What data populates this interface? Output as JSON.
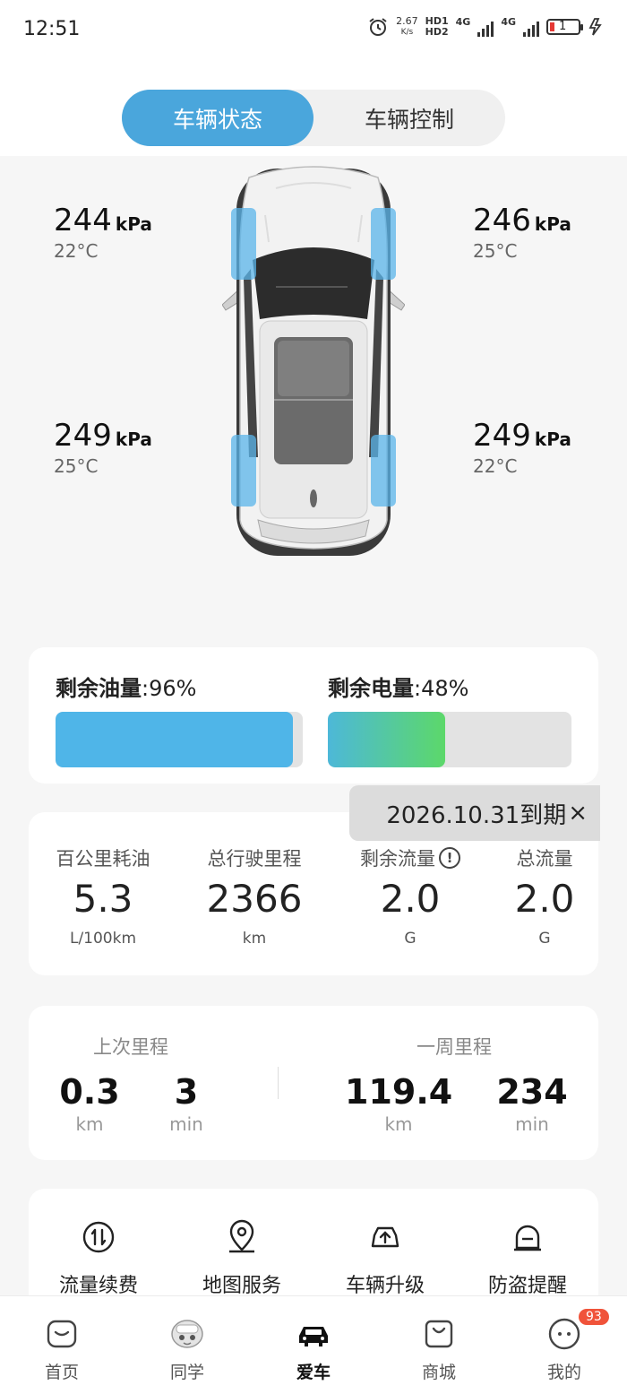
{
  "status_bar": {
    "time": "12:51",
    "net_speed_value": "2.67",
    "net_speed_unit": "K/s",
    "hd1": "HD1",
    "hd2": "HD2",
    "network1": "4G",
    "network2": "4G",
    "battery_level": "1"
  },
  "tabs": [
    {
      "label": "车辆状态",
      "active": true
    },
    {
      "label": "车辆控制",
      "active": false
    }
  ],
  "tires": {
    "front_left": {
      "pressure": "244",
      "unit": "kPa",
      "temp": "22°C"
    },
    "front_right": {
      "pressure": "246",
      "unit": "kPa",
      "temp": "25°C"
    },
    "rear_left": {
      "pressure": "249",
      "unit": "kPa",
      "temp": "25°C"
    },
    "rear_right": {
      "pressure": "249",
      "unit": "kPa",
      "temp": "22°C"
    }
  },
  "fuel": {
    "label": "剩余油量",
    "value": ":96%",
    "percent": 96
  },
  "battery": {
    "label": "剩余电量",
    "value": ":48%",
    "percent": 48
  },
  "expire_banner": {
    "text": "2026.10.31到期",
    "close": "×"
  },
  "stats": [
    {
      "label": "百公里耗油",
      "value": "5.3",
      "unit": "L/100km"
    },
    {
      "label": "总行驶里程",
      "value": "2366",
      "unit": "km"
    },
    {
      "label": "剩余流量",
      "value": "2.0",
      "unit": "G",
      "info": "!"
    },
    {
      "label": "总流量",
      "value": "2.0",
      "unit": "G"
    }
  ],
  "trips": {
    "last": {
      "label": "上次里程",
      "distance": "0.3",
      "distance_unit": "km",
      "duration": "3",
      "duration_unit": "min"
    },
    "week": {
      "label": "一周里程",
      "distance": "119.4",
      "distance_unit": "km",
      "duration": "234",
      "duration_unit": "min"
    }
  },
  "services": [
    {
      "label": "流量续费",
      "icon": "data-transfer-icon"
    },
    {
      "label": "地图服务",
      "icon": "map-pin-icon"
    },
    {
      "label": "车辆升级",
      "icon": "car-upgrade-icon"
    },
    {
      "label": "防盗提醒",
      "icon": "alarm-icon"
    }
  ],
  "bottom_nav": [
    {
      "label": "首页",
      "icon": "home-icon"
    },
    {
      "label": "同学",
      "icon": "mascot-icon"
    },
    {
      "label": "爱车",
      "icon": "car-icon",
      "active": true
    },
    {
      "label": "商城",
      "icon": "shop-bag-icon"
    },
    {
      "label": "我的",
      "icon": "chat-face-icon",
      "badge": "93"
    }
  ],
  "colors": {
    "accent": "#4aa6dc",
    "fuel_bar": "#4fb5e8",
    "battery_gradient_start": "#4db8d8",
    "battery_gradient_end": "#5cd86a",
    "tire_highlight": "#5ab4ea",
    "badge": "#f0533a"
  }
}
